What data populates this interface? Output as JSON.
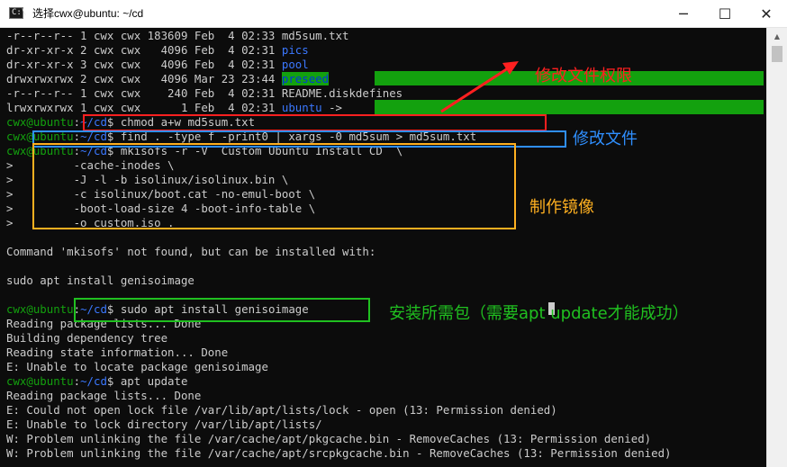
{
  "window": {
    "title": "选择cwx@ubuntu: ~/cd",
    "app_icon": "terminal-icon",
    "buttons": {
      "minimize": "─",
      "maximize": "☐",
      "close": "✕"
    }
  },
  "terminal": {
    "lines": [
      {
        "segs": [
          {
            "t": "-r--r--r-- 1 cwx cwx 183609 Feb  4 02:33 md5sum.txt",
            "c": "white"
          }
        ]
      },
      {
        "segs": [
          {
            "t": "dr-xr-xr-x 2 cwx cwx   4096 Feb  4 02:31 ",
            "c": "white"
          },
          {
            "t": "pics",
            "c": "blue"
          }
        ]
      },
      {
        "segs": [
          {
            "t": "dr-xr-xr-x 3 cwx cwx   4096 Feb  4 02:31 ",
            "c": "white"
          },
          {
            "t": "pool",
            "c": "blue"
          }
        ]
      },
      {
        "segs": [
          {
            "t": "drwxrwxrwx 2 cwx cwx   4096 Mar 23 23:44 ",
            "c": "white"
          },
          {
            "t": "preseed",
            "c": "hl"
          }
        ]
      },
      {
        "segs": [
          {
            "t": "-r--r--r-- 1 cwx cwx    240 Feb  4 02:31 README.diskdefines",
            "c": "white"
          }
        ]
      },
      {
        "segs": [
          {
            "t": "lrwxrwxrwx 1 cwx cwx      1 Feb  4 02:31 ",
            "c": "white"
          },
          {
            "t": "ubuntu",
            "c": "blue"
          },
          {
            "t": " -> ",
            "c": "white"
          }
        ]
      },
      {
        "segs": [
          {
            "t": "cwx@ubuntu",
            "c": "green"
          },
          {
            "t": ":",
            "c": "white"
          },
          {
            "t": "~/cd",
            "c": "blue"
          },
          {
            "t": "$ chmod a+w md5sum.txt",
            "c": "white"
          }
        ]
      },
      {
        "segs": [
          {
            "t": "cwx@ubuntu",
            "c": "green"
          },
          {
            "t": ":",
            "c": "white"
          },
          {
            "t": "~/cd",
            "c": "blue"
          },
          {
            "t": "$ find . -type f -print0 | xargs -0 md5sum > md5sum.txt",
            "c": "white"
          }
        ]
      },
      {
        "segs": [
          {
            "t": "cwx@ubuntu",
            "c": "green"
          },
          {
            "t": ":",
            "c": "white"
          },
          {
            "t": "~/cd",
            "c": "blue"
          },
          {
            "t": "$ mkisofs -r -V  Custom Ubuntu Install CD  \\",
            "c": "white"
          }
        ]
      },
      {
        "segs": [
          {
            "t": ">         -cache-inodes \\",
            "c": "white"
          }
        ]
      },
      {
        "segs": [
          {
            "t": ">         -J -l -b isolinux/isolinux.bin \\",
            "c": "white"
          }
        ]
      },
      {
        "segs": [
          {
            "t": ">         -c isolinux/boot.cat -no-emul-boot \\",
            "c": "white"
          }
        ]
      },
      {
        "segs": [
          {
            "t": ">         -boot-load-size 4 -boot-info-table \\",
            "c": "white"
          }
        ]
      },
      {
        "segs": [
          {
            "t": ">         -o custom.iso .",
            "c": "white"
          }
        ]
      },
      {
        "segs": [
          {
            "t": "",
            "c": "white"
          }
        ]
      },
      {
        "segs": [
          {
            "t": "Command 'mkisofs' not found, but can be installed with:",
            "c": "white"
          }
        ]
      },
      {
        "segs": [
          {
            "t": "",
            "c": "white"
          }
        ]
      },
      {
        "segs": [
          {
            "t": "sudo apt install genisoimage",
            "c": "white"
          }
        ]
      },
      {
        "segs": [
          {
            "t": "",
            "c": "white"
          }
        ]
      },
      {
        "segs": [
          {
            "t": "cwx@ubuntu",
            "c": "green"
          },
          {
            "t": ":",
            "c": "white"
          },
          {
            "t": "~/cd",
            "c": "blue"
          },
          {
            "t": "$ sudo apt install genisoimage",
            "c": "white"
          }
        ]
      },
      {
        "segs": [
          {
            "t": "Reading package lists... Done",
            "c": "white"
          }
        ]
      },
      {
        "segs": [
          {
            "t": "Building dependency tree",
            "c": "white"
          }
        ]
      },
      {
        "segs": [
          {
            "t": "Reading state information... Done",
            "c": "white"
          }
        ]
      },
      {
        "segs": [
          {
            "t": "E: Unable to locate package genisoimage",
            "c": "white"
          }
        ]
      },
      {
        "segs": [
          {
            "t": "cwx@ubuntu",
            "c": "green"
          },
          {
            "t": ":",
            "c": "white"
          },
          {
            "t": "~/cd",
            "c": "blue"
          },
          {
            "t": "$ apt update",
            "c": "white"
          }
        ]
      },
      {
        "segs": [
          {
            "t": "Reading package lists... Done",
            "c": "white"
          }
        ]
      },
      {
        "segs": [
          {
            "t": "E: Could not open lock file /var/lib/apt/lists/lock - open (13: Permission denied)",
            "c": "white"
          }
        ]
      },
      {
        "segs": [
          {
            "t": "E: Unable to lock directory /var/lib/apt/lists/",
            "c": "white"
          }
        ]
      },
      {
        "segs": [
          {
            "t": "W: Problem unlinking the file /var/cache/apt/pkgcache.bin - RemoveCaches (13: Permission denied)",
            "c": "white"
          }
        ]
      },
      {
        "segs": [
          {
            "t": "W: Problem unlinking the file /var/cache/apt/srcpkgcache.bin - RemoveCaches (13: Permission denied)",
            "c": "white"
          }
        ]
      }
    ]
  },
  "annotations": {
    "chmod": {
      "text": "修改文件权限",
      "color": "#ff2020"
    },
    "md5": {
      "text": "修改文件",
      "color": "#2f8fff"
    },
    "mkiso": {
      "text": "制作镜像",
      "color": "#ffb020"
    },
    "install": {
      "text": "安装所需包（需要apt update才能成功）",
      "color": "#20c020"
    }
  },
  "colors": {
    "terminal_bg": "#0c0c0c",
    "text": "#cccccc",
    "prompt_user": "#13a10e",
    "prompt_path": "#3b78ff",
    "dir_highlight_bg": "#13a10e",
    "dir_highlight_fg": "#0037da"
  },
  "scrollbar": {
    "up_arrow": "▲"
  }
}
